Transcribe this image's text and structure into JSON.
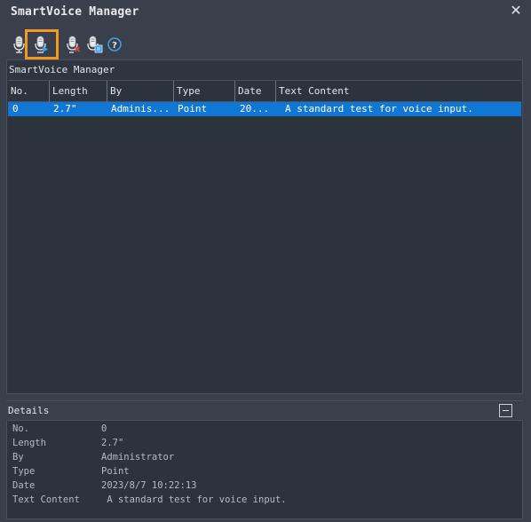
{
  "window": {
    "title": "SmartVoice Manager",
    "close_glyph": "✕"
  },
  "toolbar": {
    "buttons": [
      {
        "name": "record-voice-icon"
      },
      {
        "name": "play-voice-icon"
      },
      {
        "name": "delete-voice-icon"
      },
      {
        "name": "export-voice-icon"
      },
      {
        "name": "help-icon",
        "glyph": "?"
      }
    ]
  },
  "panel": {
    "title": "SmartVoice Manager",
    "columns": [
      "No.",
      "Length",
      "By",
      "Type",
      "Date",
      "Text Content"
    ],
    "rows": [
      {
        "no": "0",
        "length": "2.7\"",
        "by": "Adminis...",
        "type": "Point",
        "date": "20...",
        "text": "A standard test for voice input."
      }
    ]
  },
  "details": {
    "title": "Details",
    "fields": [
      {
        "key": "No.",
        "value": "0"
      },
      {
        "key": "Length",
        "value": "2.7\""
      },
      {
        "key": "By",
        "value": "Administrator"
      },
      {
        "key": "Type",
        "value": "Point"
      },
      {
        "key": "Date",
        "value": "2023/8/7 10:22:13"
      },
      {
        "key": "Text Content",
        "value": " A standard test for voice input."
      }
    ]
  },
  "colors": {
    "background": "#3a404b",
    "grid_background": "#2d333d",
    "selection": "#1177d5",
    "highlight": "#f39a1e"
  }
}
